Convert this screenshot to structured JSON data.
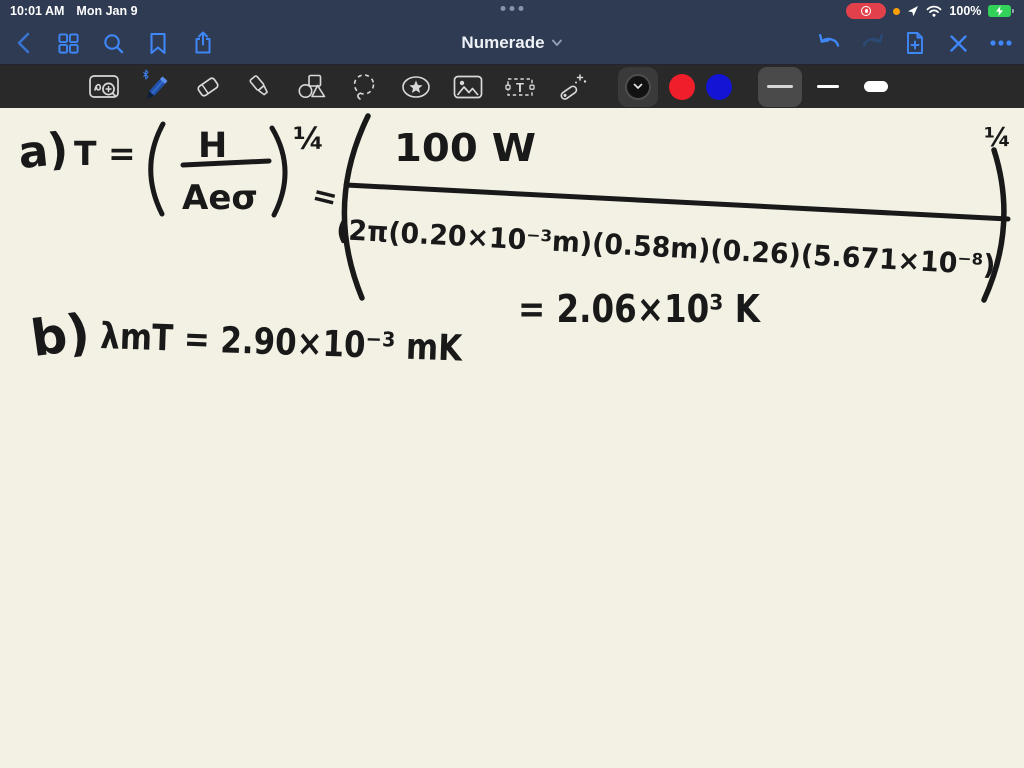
{
  "status_bar": {
    "time": "10:01 AM",
    "date": "Mon Jan 9",
    "battery": "100%"
  },
  "nav_bar": {
    "title": "Numerade"
  },
  "toolbar": {
    "text_tool_glyph": "T",
    "selected_tool": "pen",
    "selected_color": "black",
    "selected_thickness": "medium"
  },
  "canvas": {
    "part_a": {
      "label": "a)",
      "lhs": "T =",
      "inner_numerator": "H",
      "inner_denominator": "Aeσ",
      "inner_exponent": "¼",
      "equals": "=",
      "outer_numerator": "100 W",
      "outer_denominator": "(2π(0.20×10⁻³m)(0.58m)(0.26)(5.671×10⁻⁸)",
      "outer_exponent": "¼",
      "result": "= 2.06×10³ K"
    },
    "part_b": {
      "label": "b)",
      "equation": "λmT = 2.90×10⁻³ mK"
    }
  },
  "icon_names": {
    "status": [
      "recording-indicator",
      "privacy-dot",
      "location-arrow",
      "wifi",
      "battery-charging"
    ],
    "multitask": "multitasking-indicator",
    "nav_left": [
      "back",
      "pages-grid",
      "search",
      "bookmark",
      "share"
    ],
    "nav_right": [
      "undo",
      "redo",
      "add-page",
      "close",
      "more"
    ],
    "title_chevron": "chevron-down",
    "tools": [
      "zoom-writing",
      "pen",
      "eraser",
      "highlighter",
      "shapes",
      "lasso",
      "favorites",
      "media",
      "text",
      "pointer"
    ],
    "ink_colors": [
      "black",
      "red",
      "blue"
    ],
    "thicknesses": [
      "medium",
      "thin",
      "thick"
    ]
  },
  "theme": {
    "navy": "#2e3b52",
    "toolbar_bg": "#292929",
    "canvas_bg": "#f2f1e4",
    "accent_blue": "#3f86f7",
    "ink": "#191919",
    "red_swatch": "#ee1e2a",
    "blue_swatch": "#1414d4",
    "record_red": "#e2404b",
    "battery_green": "#32d158"
  }
}
